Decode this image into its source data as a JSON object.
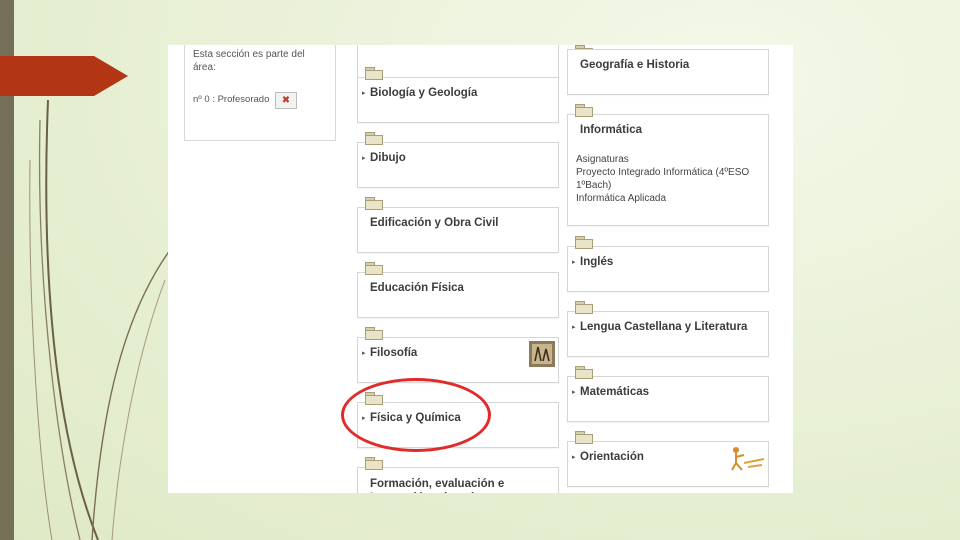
{
  "theme": {
    "accent": "#b23614",
    "highlight": "#e12a2a",
    "sidebar_bar": "#756f58"
  },
  "sidebar": {
    "description": "Esta sección es parte del área:",
    "role": "nº 0 : Profesorado",
    "remove_icon": "✖"
  },
  "left_column": [
    {
      "title": "Biología y Geología",
      "expandable": true
    },
    {
      "title": "Dibujo",
      "expandable": true
    },
    {
      "title": "Edificación y Obra Civil",
      "expandable": false
    },
    {
      "title": "Educación Física",
      "expandable": false
    },
    {
      "title": "Filosofía",
      "expandable": true
    },
    {
      "title": "Física y Química",
      "expandable": true
    },
    {
      "title": "Formación, evaluación e Innovación educativa",
      "expandable": false
    }
  ],
  "right_column": [
    {
      "title": "Geografía e Historia",
      "expandable": false
    },
    {
      "title": "Informática",
      "expandable": false,
      "items": [
        "Asignaturas",
        "Proyecto Integrado Informática (4ºESO",
        "1ºBach)",
        "Informática Aplicada"
      ]
    },
    {
      "title": "Inglés",
      "expandable": true
    },
    {
      "title": "Lengua Castellana y Literatura",
      "expandable": true
    },
    {
      "title": "Matemáticas",
      "expandable": true
    },
    {
      "title": "Orientación",
      "expandable": true
    }
  ]
}
